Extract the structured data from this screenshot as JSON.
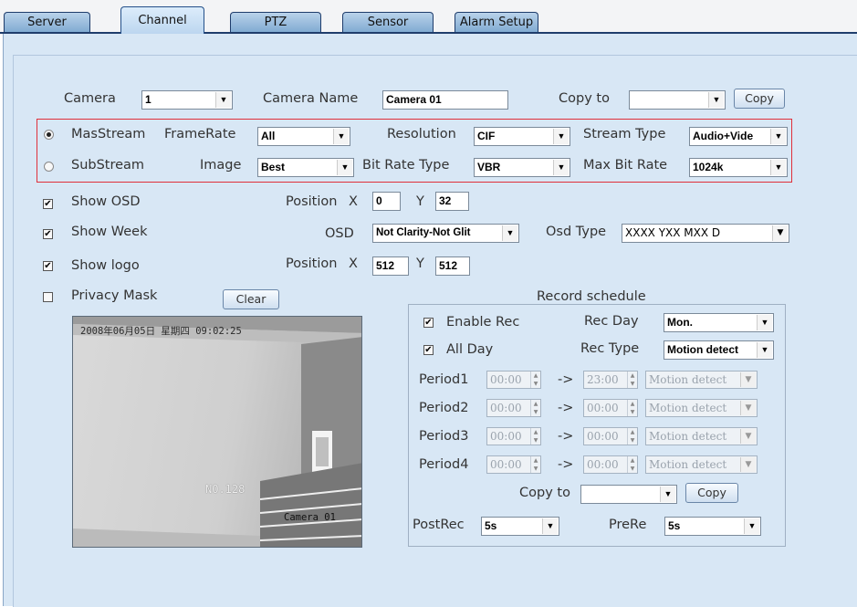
{
  "tabs": [
    "Server",
    "Channel",
    "PTZ",
    "Sensor",
    "Alarm Setup"
  ],
  "camera": {
    "label": "Camera",
    "value": "1",
    "name_label": "Camera Name",
    "name_value": "Camera 01",
    "copy_to_label": "Copy to",
    "copy_to_value": "",
    "copy_button": "Copy"
  },
  "stream": {
    "main_label": "MasStream",
    "sub_label": "SubStream",
    "selected": "MasStream",
    "framerate_label": "FrameRate",
    "framerate_value": "All",
    "resolution_label": "Resolution",
    "resolution_value": "CIF",
    "stream_type_label": "Stream Type",
    "stream_type_value": "Audio+Vide",
    "image_label": "Image",
    "image_value": "Best",
    "bitrate_type_label": "Bit Rate Type",
    "bitrate_type_value": "VBR",
    "max_bitrate_label": "Max Bit Rate",
    "max_bitrate_value": "1024k"
  },
  "osd": {
    "show_osd_label": "Show OSD",
    "show_osd_checked": true,
    "position_label": "Position",
    "x_label": "X",
    "y_label": "Y",
    "osd_x": "0",
    "osd_y": "32",
    "show_week_label": "Show Week",
    "show_week_checked": true,
    "osd_label": "OSD",
    "osd_value": "Not Clarity-Not Glit",
    "osd_type_label": "Osd Type",
    "osd_type_value": "XXXX YXX MXX D",
    "show_logo_label": "Show logo",
    "show_logo_checked": true,
    "logo_x": "512",
    "logo_y": "512",
    "privacy_label": "Privacy Mask",
    "privacy_checked": false,
    "clear_button": "Clear"
  },
  "preview": {
    "timestamp": "2008年06月05日 星期四 09:02:25",
    "number_label": "NO.128",
    "camera_label": "Camera 01"
  },
  "schedule": {
    "title": "Record schedule",
    "enable_label": "Enable Rec",
    "enable_checked": true,
    "all_day_label": "All Day",
    "all_day_checked": true,
    "rec_day_label": "Rec Day",
    "rec_day_value": "Mon.",
    "rec_type_label": "Rec Type",
    "rec_type_value": "Motion detect",
    "arrow": "->",
    "periods": [
      {
        "label": "Period1",
        "start": "00:00",
        "end": "23:00",
        "type": "Motion detect"
      },
      {
        "label": "Period2",
        "start": "00:00",
        "end": "00:00",
        "type": "Motion detect"
      },
      {
        "label": "Period3",
        "start": "00:00",
        "end": "00:00",
        "type": "Motion detect"
      },
      {
        "label": "Period4",
        "start": "00:00",
        "end": "00:00",
        "type": "Motion detect"
      }
    ],
    "copy_to_label": "Copy to",
    "copy_to_value": "",
    "copy_button": "Copy",
    "postrec_label": "PostRec",
    "postrec_value": "5s",
    "prerec_label": "PreRe",
    "prerec_value": "5s"
  },
  "icons": {
    "dropdown": "chevron-down-icon",
    "check": "checkmark-icon"
  },
  "colors": {
    "panel": "#d8e7f5",
    "highlight_border": "#e0303a",
    "tab_border": "#1f3d6c"
  }
}
